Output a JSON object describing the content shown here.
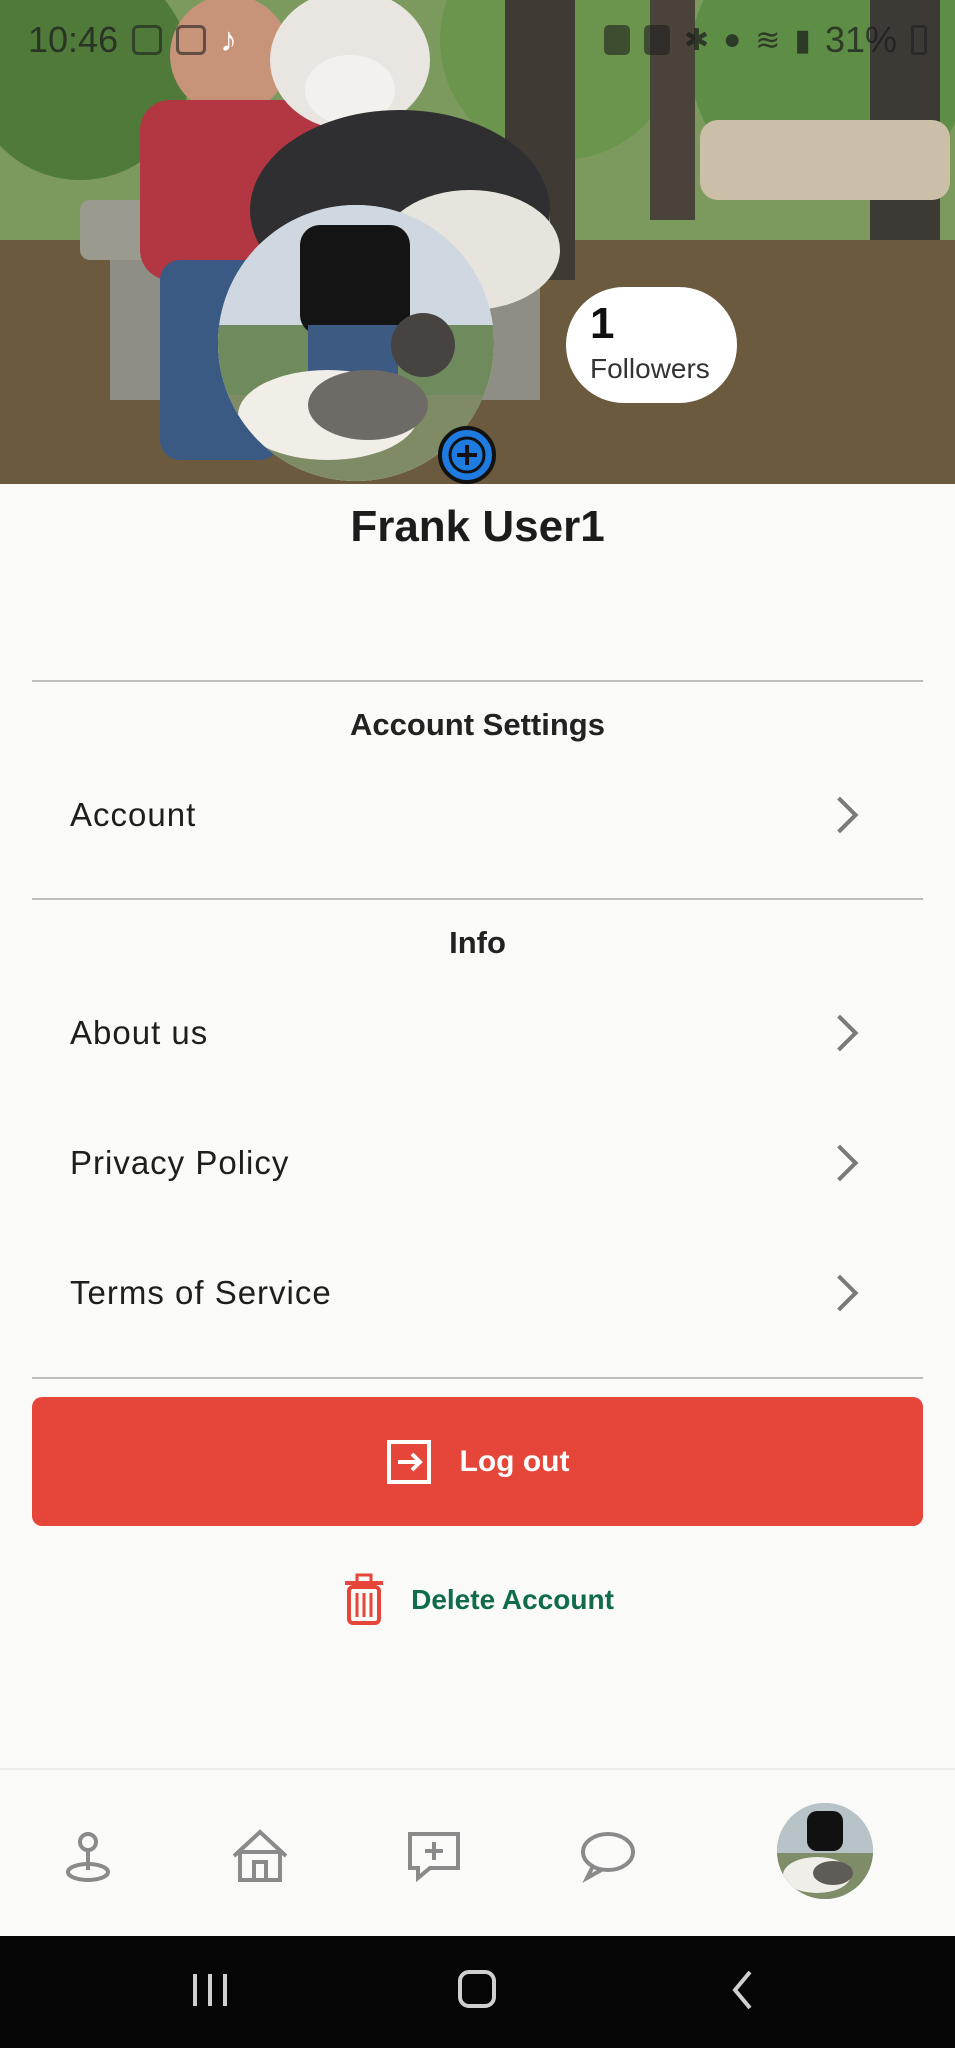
{
  "status_bar": {
    "time": "10:46",
    "battery": "31%"
  },
  "profile": {
    "followers_count": "1",
    "followers_label": "Followers",
    "name": "Frank User1"
  },
  "sections": [
    {
      "title": "Account Settings",
      "items": [
        {
          "label": "Account"
        }
      ]
    },
    {
      "title": "Info",
      "items": [
        {
          "label": "About us"
        },
        {
          "label": "Privacy Policy"
        },
        {
          "label": "Terms of Service"
        }
      ]
    }
  ],
  "actions": {
    "logout_label": "Log out",
    "delete_label": "Delete Account"
  },
  "bottom_nav": {
    "items": [
      {
        "icon": "map-pin-icon"
      },
      {
        "icon": "home-icon"
      },
      {
        "icon": "add-post-icon"
      },
      {
        "icon": "chat-icon"
      },
      {
        "icon": "profile-avatar"
      }
    ]
  },
  "colors": {
    "logout_button": "#e64639",
    "delete_text": "#0f6b4a",
    "background": "#fafbf8"
  }
}
